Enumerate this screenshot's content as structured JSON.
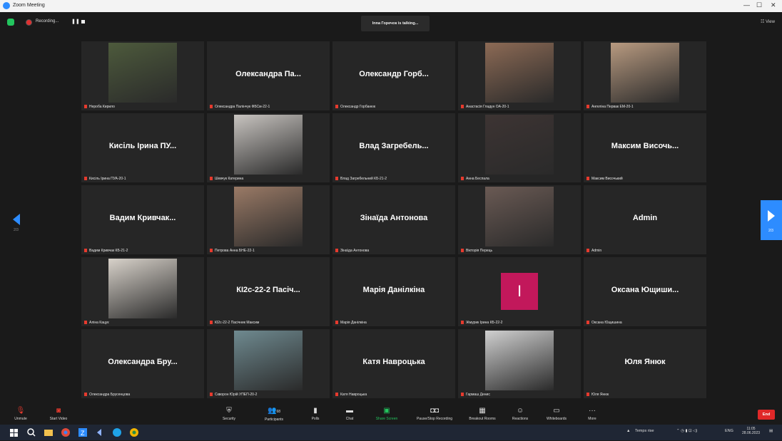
{
  "window": {
    "title": "Zoom Meeting",
    "controls": [
      "—",
      "☐",
      "✕"
    ]
  },
  "topbar": {
    "recording_label": "Recording...",
    "pause_glyph": "❚❚",
    "speaking": "Inna Горечок is talking...",
    "view_label": "☷ View"
  },
  "pager": {
    "left": "2/3",
    "right": "2/3"
  },
  "participants": [
    {
      "name": "",
      "label": "Нероба Кирило",
      "photo": "#4d5a3c"
    },
    {
      "name": "Олександра Па...",
      "label": "Олександра Палінчук ФБСм-22-1"
    },
    {
      "name": "Олександр Горб...",
      "label": "Олександр Горбанюк"
    },
    {
      "name": "",
      "label": "Анастасія Гладун ОА-20-1",
      "photo": "#8c6a55"
    },
    {
      "name": "",
      "label": "Ангеліна Первак ЕМ-20-1",
      "photo": "#b89a80"
    },
    {
      "name": "Кисіль Ірина ПУ...",
      "label": "Кисіль Ірина ПУА-20-1"
    },
    {
      "name": "",
      "label": "Шевчук Катерина",
      "photo": "#c8c4c0"
    },
    {
      "name": "Влад Загребель...",
      "label": "Влад Загребельний КБ-21-2"
    },
    {
      "name": "",
      "label": "Анна Беспала",
      "photo": "#3d3433"
    },
    {
      "name": "Максим Височь...",
      "label": "Максим Височький"
    },
    {
      "name": "Вадим Кривчак...",
      "label": "Вадим Кривчак КБ-21-2"
    },
    {
      "name": "",
      "label": "Петрова Анна БНЕ-22-1",
      "photo": "#9a7a66"
    },
    {
      "name": "Зінаїда Антонова",
      "label": "Зінаїда Антонова"
    },
    {
      "name": "",
      "label": "Вікторія Перець",
      "photo": "#6a5a54"
    },
    {
      "name": "Admin",
      "label": "Admin"
    },
    {
      "name": "",
      "label": "Аліна Кацук",
      "photo": "#d8d2ca"
    },
    {
      "name": "КІ2с-22-2 Пасіч...",
      "label": "КІ2с-22-2 Пасічник Максим"
    },
    {
      "name": "Марія Данілкіна",
      "label": "Марія Данілкіна"
    },
    {
      "name": "I",
      "label": "Жмурик Ірина КБ-22-2",
      "avatar": "#c2185b"
    },
    {
      "name": "Оксана Ющиши...",
      "label": "Оксана Ющишина"
    },
    {
      "name": "Олександра Бру...",
      "label": "Олександра Брусенцова"
    },
    {
      "name": "",
      "label": "Скворон Юрій УПЕП-20-2",
      "photo": "#6f8a90"
    },
    {
      "name": "Катя Навроцька",
      "label": "Катя Навроцька"
    },
    {
      "name": "",
      "label": "Гармаш Денис",
      "photo": "#d0d0d0"
    },
    {
      "name": "Юля Янюк",
      "label": "Юля Янюк"
    }
  ],
  "toolbar": {
    "unmute": "Unmute",
    "start_video": "Start Video",
    "security": "Security",
    "participants": "Participants",
    "participants_count": "68",
    "polls": "Polls",
    "chat": "Chat",
    "share_screen": "Share Screen",
    "pause_stop_recording": "Pause/Stop Recording",
    "breakout_rooms": "Breakout Rooms",
    "reactions": "Reactions",
    "whiteboards": "Whiteboards",
    "more": "More",
    "end": "End"
  },
  "taskbar": {
    "weather": "Temps rise",
    "lang": "ENG",
    "time": "11:05",
    "date": "28.06.2023"
  },
  "colors": {
    "accent": "#2d8cff",
    "mic_off": "#e63a2e",
    "share_green": "#23c55e",
    "end_red": "#e02828"
  }
}
